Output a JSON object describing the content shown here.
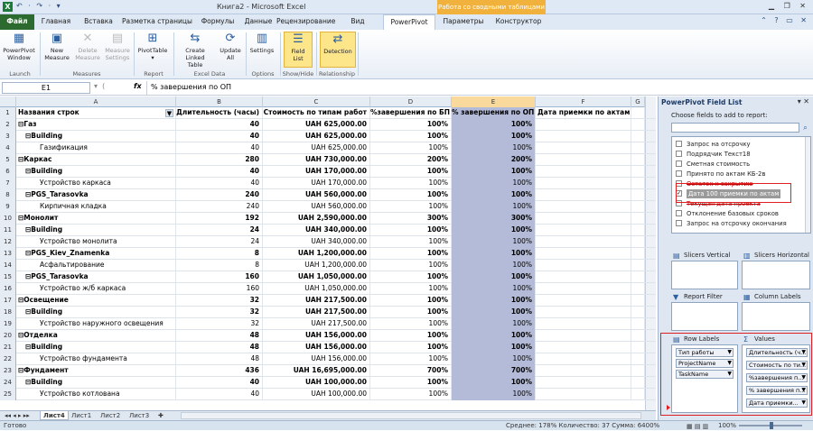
{
  "window": {
    "title": "Книга2 - Microsoft Excel",
    "context_title": "Работа со сводными таблицами",
    "qat": "↶ · ↷ · ▾"
  },
  "tabs": [
    "Файл",
    "Главная",
    "Вставка",
    "Разметка страницы",
    "Формулы",
    "Данные",
    "Рецензирование",
    "Вид",
    "PowerPivot",
    "Параметры",
    "Конструктор"
  ],
  "ribbon": {
    "buttons": [
      {
        "label": "PowerPivot\nWindow",
        "icon": "grid-icon"
      },
      {
        "label": "New\nMeasure",
        "icon": "measure-icon"
      },
      {
        "label": "Delete\nMeasure",
        "icon": "delete-icon"
      },
      {
        "label": "Measure\nSettings",
        "icon": "settings-icon"
      },
      {
        "label": "PivotTable\n▾",
        "icon": "pivot-icon"
      },
      {
        "label": "Create\nLinked Table",
        "icon": "linked-table-icon"
      },
      {
        "label": "Update\nAll",
        "icon": "update-icon"
      },
      {
        "label": "Settings",
        "icon": "doc-settings-icon"
      },
      {
        "label": "Field\nList",
        "icon": "field-list-icon"
      },
      {
        "label": "Detection",
        "icon": "detection-icon"
      }
    ],
    "groups": [
      "Launch",
      "Measures",
      "Report",
      "Excel Data",
      "Options",
      "Show/Hide",
      "Relationship"
    ]
  },
  "formula_bar": {
    "cell": "E1",
    "fx": "fx",
    "content": "% завершения по ОП"
  },
  "columns": [
    "A",
    "B",
    "C",
    "D",
    "E",
    "F",
    "G"
  ],
  "header_row": [
    "Названия строк",
    "Длительность (часы)",
    "Стоимость по типам работ",
    "%завершения по БП",
    "% завершения по ОП",
    "Дата приемки по актам"
  ],
  "rows": [
    {
      "n": "2",
      "a": "⊟Газ",
      "b": "40",
      "c": "UAH 625,000.00",
      "d": "100%",
      "e": "100%",
      "lvl": 0,
      "bold": true
    },
    {
      "n": "3",
      "a": "⊟Building",
      "b": "40",
      "c": "UAH 625,000.00",
      "d": "100%",
      "e": "100%",
      "lvl": 1,
      "bold": true
    },
    {
      "n": "4",
      "a": "Газификация",
      "b": "40",
      "c": "UAH 625,000.00",
      "d": "100%",
      "e": "100%",
      "lvl": 2,
      "bold": false
    },
    {
      "n": "5",
      "a": "⊟Каркас",
      "b": "280",
      "c": "UAH 730,000.00",
      "d": "200%",
      "e": "200%",
      "lvl": 0,
      "bold": true
    },
    {
      "n": "6",
      "a": "⊟Building",
      "b": "40",
      "c": "UAH 170,000.00",
      "d": "100%",
      "e": "100%",
      "lvl": 1,
      "bold": true
    },
    {
      "n": "7",
      "a": "Устройство каркаса",
      "b": "40",
      "c": "UAH 170,000.00",
      "d": "100%",
      "e": "100%",
      "lvl": 2,
      "bold": false
    },
    {
      "n": "8",
      "a": "⊟PGS_Tarasovka",
      "b": "240",
      "c": "UAH 560,000.00",
      "d": "100%",
      "e": "100%",
      "lvl": 1,
      "bold": true
    },
    {
      "n": "9",
      "a": "Кирпичная кладка",
      "b": "240",
      "c": "UAH 560,000.00",
      "d": "100%",
      "e": "100%",
      "lvl": 2,
      "bold": false
    },
    {
      "n": "10",
      "a": "⊟Монолит",
      "b": "192",
      "c": "UAH 2,590,000.00",
      "d": "300%",
      "e": "300%",
      "lvl": 0,
      "bold": true
    },
    {
      "n": "11",
      "a": "⊟Building",
      "b": "24",
      "c": "UAH 340,000.00",
      "d": "100%",
      "e": "100%",
      "lvl": 1,
      "bold": true
    },
    {
      "n": "12",
      "a": "Устройство монолита",
      "b": "24",
      "c": "UAH 340,000.00",
      "d": "100%",
      "e": "100%",
      "lvl": 2,
      "bold": false
    },
    {
      "n": "13",
      "a": "⊟PGS_Kiev_Znamenka",
      "b": "8",
      "c": "UAH 1,200,000.00",
      "d": "100%",
      "e": "100%",
      "lvl": 1,
      "bold": true
    },
    {
      "n": "14",
      "a": "Асфальтирование",
      "b": "8",
      "c": "UAH 1,200,000.00",
      "d": "100%",
      "e": "100%",
      "lvl": 2,
      "bold": false
    },
    {
      "n": "15",
      "a": "⊟PGS_Tarasovka",
      "b": "160",
      "c": "UAH 1,050,000.00",
      "d": "100%",
      "e": "100%",
      "lvl": 1,
      "bold": true
    },
    {
      "n": "16",
      "a": "Устройство ж/б каркаса",
      "b": "160",
      "c": "UAH 1,050,000.00",
      "d": "100%",
      "e": "100%",
      "lvl": 2,
      "bold": false
    },
    {
      "n": "17",
      "a": "⊟Освещение",
      "b": "32",
      "c": "UAH 217,500.00",
      "d": "100%",
      "e": "100%",
      "lvl": 0,
      "bold": true
    },
    {
      "n": "18",
      "a": "⊟Building",
      "b": "32",
      "c": "UAH 217,500.00",
      "d": "100%",
      "e": "100%",
      "lvl": 1,
      "bold": true
    },
    {
      "n": "19",
      "a": "Устройство наружного освещения",
      "b": "32",
      "c": "UAH 217,500.00",
      "d": "100%",
      "e": "100%",
      "lvl": 2,
      "bold": false
    },
    {
      "n": "20",
      "a": "⊟Отделка",
      "b": "48",
      "c": "UAH 156,000.00",
      "d": "100%",
      "e": "100%",
      "lvl": 0,
      "bold": true
    },
    {
      "n": "21",
      "a": "⊟Building",
      "b": "48",
      "c": "UAH 156,000.00",
      "d": "100%",
      "e": "100%",
      "lvl": 1,
      "bold": true
    },
    {
      "n": "22",
      "a": "Устройство фундамента",
      "b": "48",
      "c": "UAH 156,000.00",
      "d": "100%",
      "e": "100%",
      "lvl": 2,
      "bold": false
    },
    {
      "n": "23",
      "a": "⊟Фундамент",
      "b": "436",
      "c": "UAH 16,695,000.00",
      "d": "700%",
      "e": "700%",
      "lvl": 0,
      "bold": true
    },
    {
      "n": "24",
      "a": "⊟Building",
      "b": "40",
      "c": "UAH 100,000.00",
      "d": "100%",
      "e": "100%",
      "lvl": 1,
      "bold": true
    },
    {
      "n": "25",
      "a": "Устройство котлована",
      "b": "40",
      "c": "UAH 100,000.00",
      "d": "100%",
      "e": "100%",
      "lvl": 2,
      "bold": false
    }
  ],
  "sheets": [
    "Лист4",
    "Лист1",
    "Лист2",
    "Лист3"
  ],
  "status": {
    "ready": "Готово",
    "summary": "Среднее: 178%   Количество: 37   Сумма: 6400%",
    "zoom": "100%"
  },
  "field_list": {
    "title": "PowerPivot Field List",
    "choose": "Choose fields to add to report:",
    "fields": [
      {
        "label": "Запрос на отсрочку",
        "checked": false,
        "style": ""
      },
      {
        "label": "Подрядчик Текст18",
        "checked": false,
        "style": ""
      },
      {
        "label": "Сметная стоимость",
        "checked": false,
        "style": ""
      },
      {
        "label": "Принято по актам КБ-2в",
        "checked": false,
        "style": ""
      },
      {
        "label": "Остаток к закрытию",
        "checked": false,
        "style": "strike"
      },
      {
        "label": "Дата 100 приемки по актам",
        "checked": true,
        "style": "hlt"
      },
      {
        "label": "Текущая дата проекта",
        "checked": false,
        "style": "strike"
      },
      {
        "label": "Отклонение базовых сроков",
        "checked": false,
        "style": ""
      },
      {
        "label": "Запрос на отсрочку окончания",
        "checked": false,
        "style": ""
      }
    ],
    "zones": {
      "slicers_vertical": "Slicers Vertical",
      "slicers_horizontal": "Slicers Horizontal",
      "report_filter": "Report Filter",
      "column_labels": "Column Labels",
      "row_labels": "Row Labels",
      "values": "Values"
    },
    "row_fields": [
      "Тип работы",
      "ProjectName",
      "TaskName"
    ],
    "value_fields": [
      "Длительность (ч...",
      "Стоимость по ти...",
      "%завершения п...",
      "% завершения п...",
      "Дата приемки..."
    ]
  }
}
